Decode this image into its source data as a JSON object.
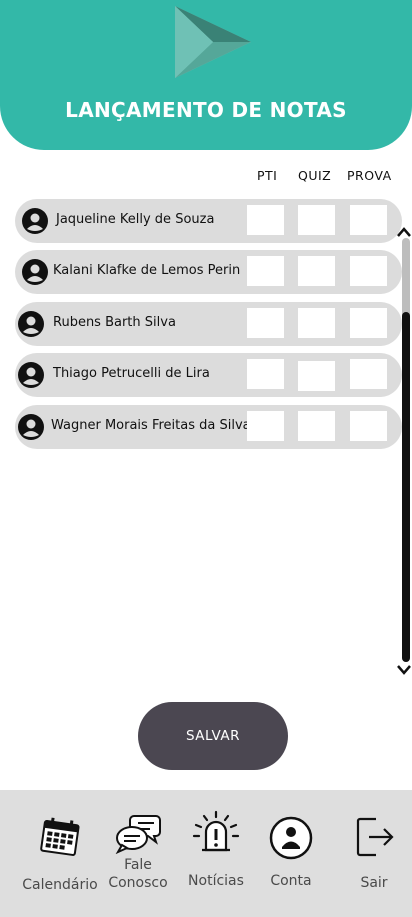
{
  "header": {
    "title": "LANÇAMENTO DE NOTAS",
    "logo_icon": "play-triangle-logo"
  },
  "columns": [
    "PTI",
    "QUIZ",
    "PROVA"
  ],
  "students": [
    {
      "name": "Jaqueline Kelly de Souza",
      "pti": "",
      "quiz": "",
      "prova": ""
    },
    {
      "name": "Kalani Klafke de Lemos Perin",
      "pti": "",
      "quiz": "",
      "prova": ""
    },
    {
      "name": "Rubens Barth Silva",
      "pti": "",
      "quiz": "",
      "prova": ""
    },
    {
      "name": "Thiago Petrucelli de Lira",
      "pti": "",
      "quiz": "",
      "prova": ""
    },
    {
      "name": "Wagner Morais Freitas da Silva",
      "pti": "",
      "quiz": "",
      "prova": ""
    }
  ],
  "save_label": "SALVAR",
  "nav": [
    {
      "label": "Calendário",
      "icon": "calendar-icon"
    },
    {
      "label": "Fale Conosco",
      "icon": "chat-bubbles-icon"
    },
    {
      "label": "Notícias",
      "icon": "alert-icon"
    },
    {
      "label": "Conta",
      "icon": "account-icon"
    },
    {
      "label": "Sair",
      "icon": "logout-icon"
    }
  ],
  "colors": {
    "header": "#33b8a8",
    "row": "#dcdcdc",
    "save_button": "#4b4751",
    "bottom_bar": "#dedede"
  }
}
